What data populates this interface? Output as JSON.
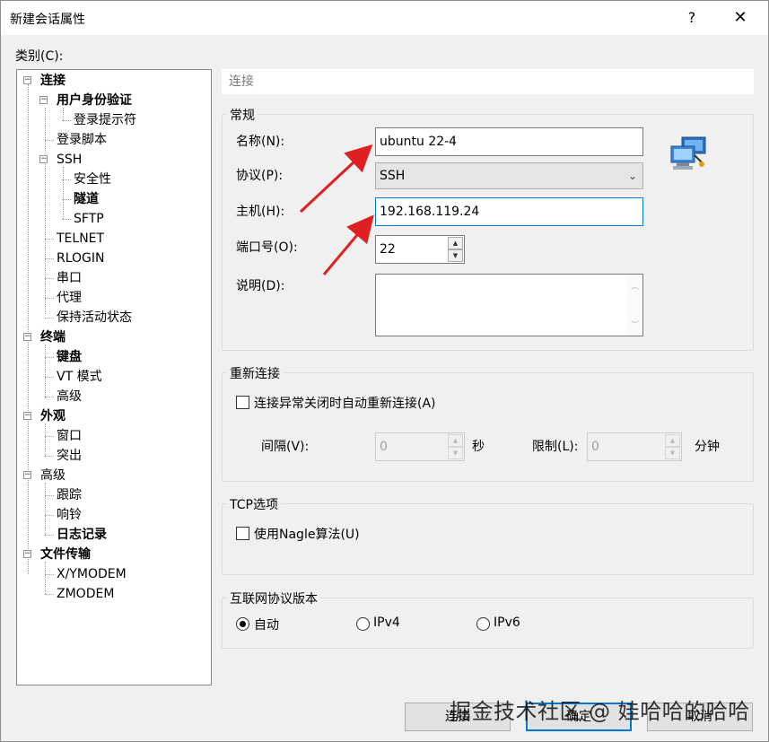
{
  "window": {
    "title": "新建会话属性",
    "help_label": "?",
    "close_label": "✕"
  },
  "category_label": "类别(C):",
  "tree": [
    {
      "label": "连接",
      "bold": true
    },
    {
      "label": "用户身份验证",
      "bold": true
    },
    {
      "label": "登录提示符",
      "bold": false
    },
    {
      "label": "登录脚本",
      "bold": false
    },
    {
      "label": "SSH",
      "bold": false
    },
    {
      "label": "安全性",
      "bold": false
    },
    {
      "label": "隧道",
      "bold": true
    },
    {
      "label": "SFTP",
      "bold": false
    },
    {
      "label": "TELNET",
      "bold": false
    },
    {
      "label": "RLOGIN",
      "bold": false
    },
    {
      "label": "串口",
      "bold": false
    },
    {
      "label": "代理",
      "bold": false
    },
    {
      "label": "保持活动状态",
      "bold": false
    },
    {
      "label": "终端",
      "bold": true
    },
    {
      "label": "键盘",
      "bold": true
    },
    {
      "label": "VT 模式",
      "bold": false
    },
    {
      "label": "高级",
      "bold": false
    },
    {
      "label": "外观",
      "bold": true
    },
    {
      "label": "窗口",
      "bold": false
    },
    {
      "label": "突出",
      "bold": false
    },
    {
      "label": "高级",
      "bold": false
    },
    {
      "label": "跟踪",
      "bold": false
    },
    {
      "label": "响铃",
      "bold": false
    },
    {
      "label": "日志记录",
      "bold": true
    },
    {
      "label": "文件传输",
      "bold": true
    },
    {
      "label": "X/YMODEM",
      "bold": false
    },
    {
      "label": "ZMODEM",
      "bold": false
    }
  ],
  "section_header": "连接",
  "general": {
    "title": "常规",
    "name_label": "名称(N):",
    "name_value": "ubuntu 22-4",
    "protocol_label": "协议(P):",
    "protocol_value": "SSH",
    "host_label": "主机(H):",
    "host_value": "192.168.119.24",
    "port_label": "端口号(O):",
    "port_value": "22",
    "desc_label": "说明(D):",
    "desc_value": ""
  },
  "reconnect": {
    "title": "重新连接",
    "auto_label": "连接异常关闭时自动重新连接(A)",
    "interval_label": "间隔(V):",
    "interval_value": "0",
    "interval_unit": "秒",
    "limit_label": "限制(L):",
    "limit_value": "0",
    "limit_unit": "分钟"
  },
  "tcp": {
    "title": "TCP选项",
    "nagle_label": "使用Nagle算法(U)"
  },
  "ip_version": {
    "title": "互联网协议版本",
    "auto_label": "自动",
    "ipv4_label": "IPv4",
    "ipv6_label": "IPv6",
    "selected": "auto"
  },
  "buttons": {
    "connect": "连接",
    "ok": "确定",
    "cancel": "取消"
  },
  "watermark": "掘金技术社区 @ 娃哈哈的哈哈",
  "colors": {
    "accent": "#0078d7",
    "arrow": "#e02020"
  }
}
